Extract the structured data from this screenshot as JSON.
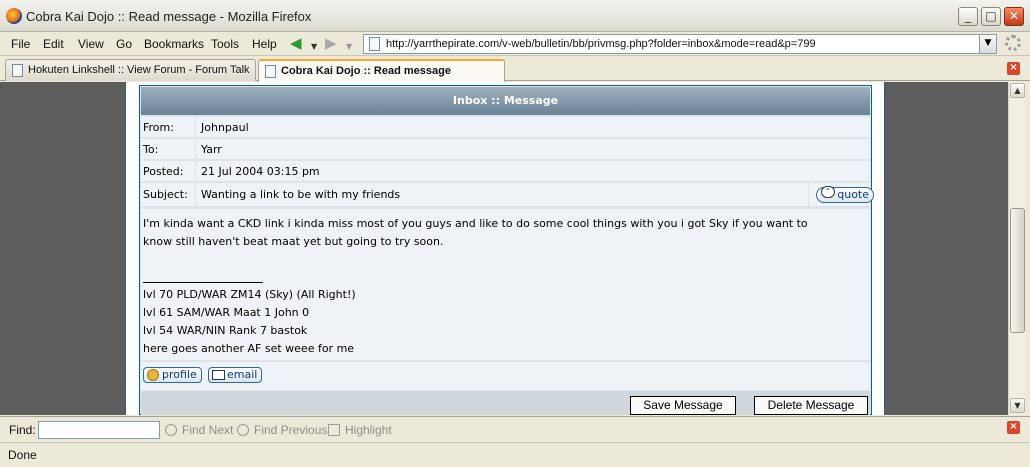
{
  "window": {
    "title": "Cobra Kai Dojo :: Read message - Mozilla Firefox",
    "controls": [
      "_",
      "□",
      "✕"
    ]
  },
  "menu": [
    "File",
    "Edit",
    "View",
    "Go",
    "Bookmarks",
    "Tools",
    "Help"
  ],
  "address": {
    "url": "http://yarrthepirate.com/v-web/bulletin/bb/privmsg.php?folder=inbox&mode=read&p=799"
  },
  "tabs": [
    {
      "label": "Hokuten Linkshell :: View Forum - Forum Talk",
      "active": false
    },
    {
      "label": "Cobra Kai Dojo :: Read message",
      "active": true
    }
  ],
  "message": {
    "header": "Inbox :: Message",
    "from_label": "From:",
    "from": "Johnpaul",
    "to_label": "To:",
    "to": "Yarr",
    "posted_label": "Posted:",
    "posted": "21 Jul 2004 03:15 pm",
    "subject_label": "Subject:",
    "subject": "Wanting a link to be with my friends",
    "quote_label": "quote",
    "body_line1": "I'm kinda want a CKD link i kinda miss most of you guys and like to do some cool things with you i got Sky if you want to",
    "body_line2": "know still haven't beat maat yet but going to try soon.",
    "signature": [
      "lvl 70 PLD/WAR ZM14 (Sky) (All Right!)",
      "lvl 61 SAM/WAR Maat 1 John 0",
      "lvl 54 WAR/NIN Rank 7 bastok",
      "here goes another AF set weee for me"
    ],
    "profile_label": "profile",
    "email_label": "email",
    "save_label": "Save Message",
    "delete_label": "Delete Message"
  },
  "findbar": {
    "label": "Find:",
    "value": "",
    "next": "Find Next",
    "previous": "Find Previous",
    "highlight": "Highlight"
  },
  "status": "Done",
  "icons": {
    "app": "firefox-icon",
    "back": "back-arrow-icon",
    "forward": "forward-arrow-icon",
    "page": "page-icon",
    "close": "close-icon"
  },
  "colors": {
    "header_bar": "#6a8397",
    "row_bg": "#eff3f7",
    "border": "#006699",
    "page_bg": "#5d5d5d"
  }
}
